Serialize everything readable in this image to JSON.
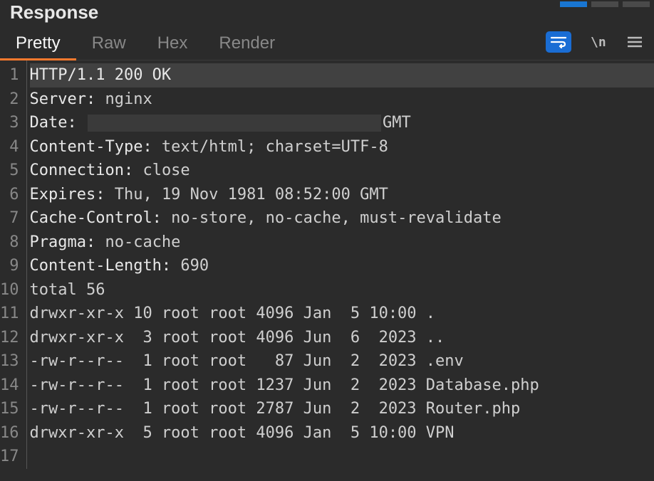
{
  "panel_title": "Response",
  "tabs": [
    "Pretty",
    "Raw",
    "Hex",
    "Render"
  ],
  "active_tab_index": 0,
  "line_numbers": [
    "1",
    "2",
    "3",
    "4",
    "5",
    "6",
    "7",
    "8",
    "9",
    "10",
    "11",
    "12",
    "13",
    "14",
    "15",
    "16",
    "17"
  ],
  "status_line": "HTTP/1.1 200 OK",
  "headers": [
    {
      "name": "Server:",
      "value": " nginx"
    },
    {
      "name": "Date:",
      "value_suffix": "GMT",
      "redacted": true
    },
    {
      "name": "Content-Type:",
      "value": " text/html; charset=UTF-8"
    },
    {
      "name": "Connection:",
      "value": " close"
    },
    {
      "name": "Expires:",
      "value": " Thu, 19 Nov 1981 08:52:00 GMT"
    },
    {
      "name": "Cache-Control:",
      "value": " no-store, no-cache, must-revalidate"
    },
    {
      "name": "Pragma:",
      "value": " no-cache"
    },
    {
      "name": "Content-Length:",
      "value": " 690"
    }
  ],
  "body_lines": [
    "",
    "total 56",
    "drwxr-xr-x 10 root root 4096 Jan  5 10:00 .",
    "drwxr-xr-x  3 root root 4096 Jun  6  2023 ..",
    "-rw-r--r--  1 root root   87 Jun  2  2023 .env",
    "-rw-r--r--  1 root root 1237 Jun  2  2023 Database.php",
    "-rw-r--r--  1 root root 2787 Jun  2  2023 Router.php",
    "drwxr-xr-x  5 root root 4096 Jan  5 10:00 VPN"
  ]
}
